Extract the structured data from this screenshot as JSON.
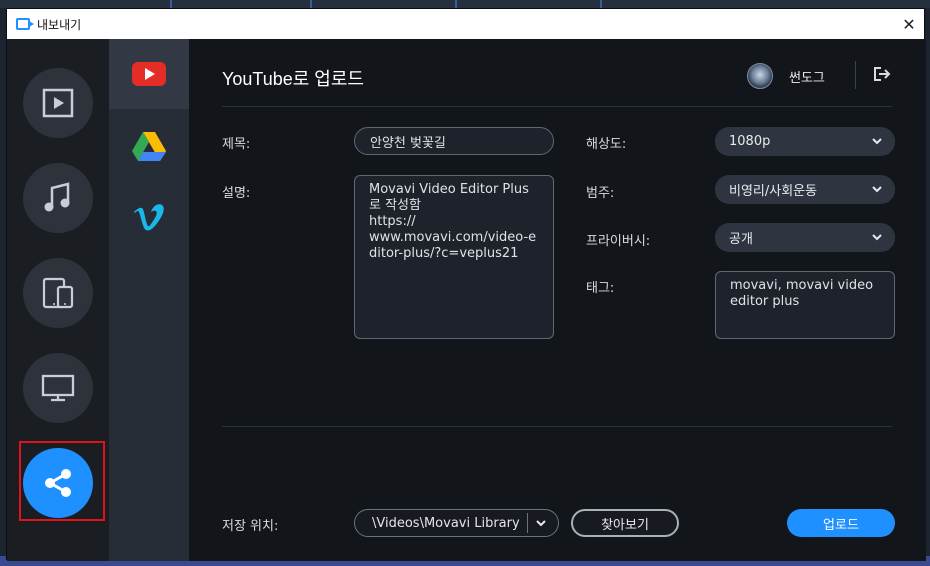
{
  "window": {
    "title": "내보내기",
    "close_glyph": "✕"
  },
  "rail": {
    "items": [
      {
        "name": "video",
        "icon": "video-file-icon"
      },
      {
        "name": "audio",
        "icon": "music-note-icon"
      },
      {
        "name": "devices",
        "icon": "devices-icon"
      },
      {
        "name": "tv",
        "icon": "monitor-icon"
      },
      {
        "name": "share",
        "icon": "share-icon",
        "active": true
      }
    ]
  },
  "services": {
    "items": [
      {
        "name": "youtube",
        "icon": "youtube-icon",
        "active": true
      },
      {
        "name": "google-drive",
        "icon": "google-drive-icon"
      },
      {
        "name": "vimeo",
        "icon": "vimeo-icon"
      }
    ]
  },
  "header": {
    "title": "YouTube로 업로드",
    "account_name": "썬도그"
  },
  "form": {
    "title_label": "제목:",
    "title_value": "안양천 벚꽃길",
    "description_label": "설명:",
    "description_value": "Movavi Video Editor Plus\n로 작성함\nhttps://\nwww.movavi.com/video-editor-plus/?c=veplus21",
    "resolution_label": "해상도:",
    "resolution_value": "1080p",
    "category_label": "범주:",
    "category_value": "비영리/사회운동",
    "privacy_label": "프라이버시:",
    "privacy_value": "공개",
    "tags_label": "태그:",
    "tags_value": "movavi, movavi video editor plus"
  },
  "footer": {
    "save_location_label": "저장 위치:",
    "save_location_value": "\\Videos\\Movavi Library",
    "browse_label": "찾아보기",
    "upload_label": "업로드"
  },
  "colors": {
    "accent": "#1e90ff",
    "dialog_bg": "#121519",
    "selection_highlight": "#e0131a",
    "youtube_red": "#e52d27",
    "vimeo_blue": "#1ab7ea"
  }
}
